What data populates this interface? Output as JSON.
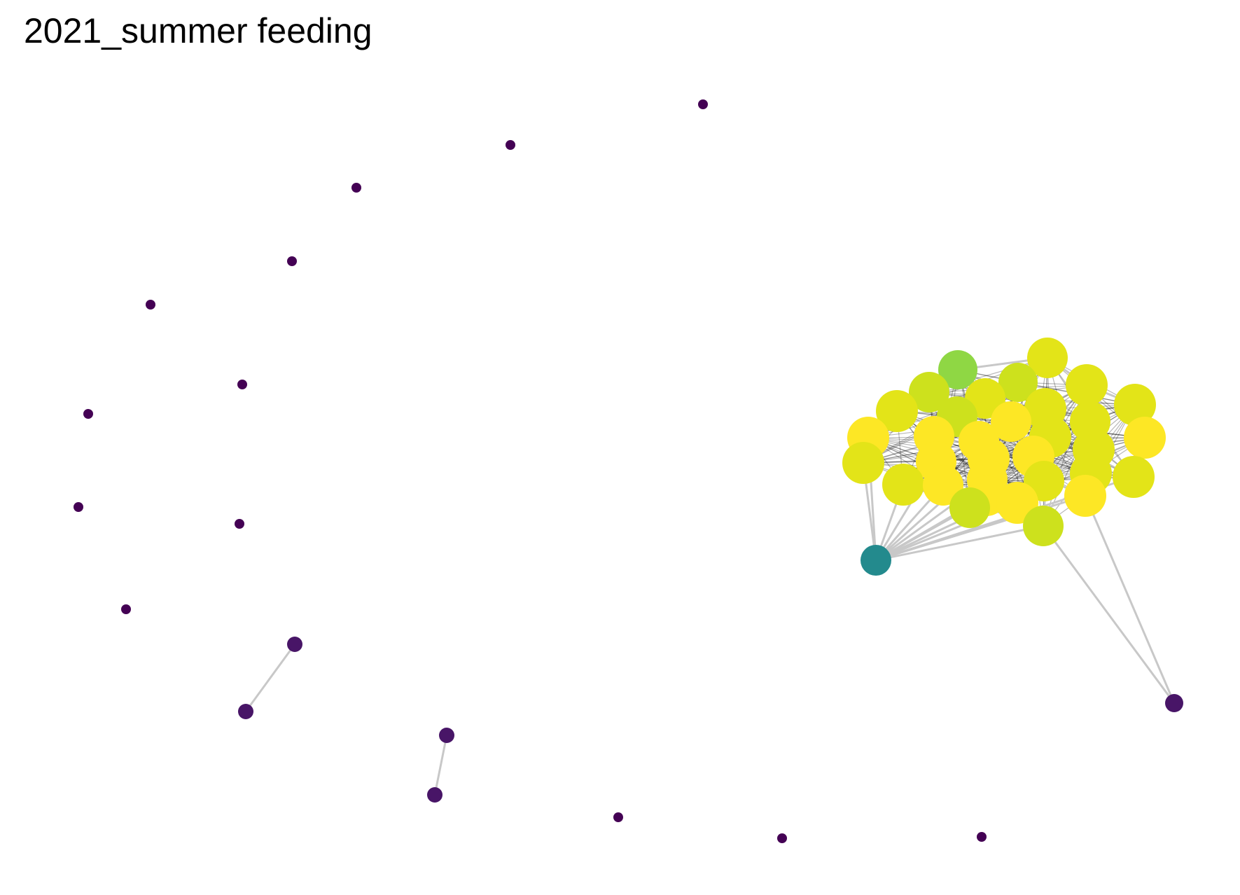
{
  "title": "2021_summer feeding",
  "colors": {
    "background": "#ffffff",
    "edge_light": "#c8c8c8",
    "edge_dense": "#000000",
    "isolated_node": "#440154",
    "paired_node": "#481567",
    "hub_teal": "#238a8d",
    "green": "#8fd744",
    "yellow_green": "#cde11d",
    "yellow_light": "#e3e418",
    "yellow": "#fde725"
  }
}
